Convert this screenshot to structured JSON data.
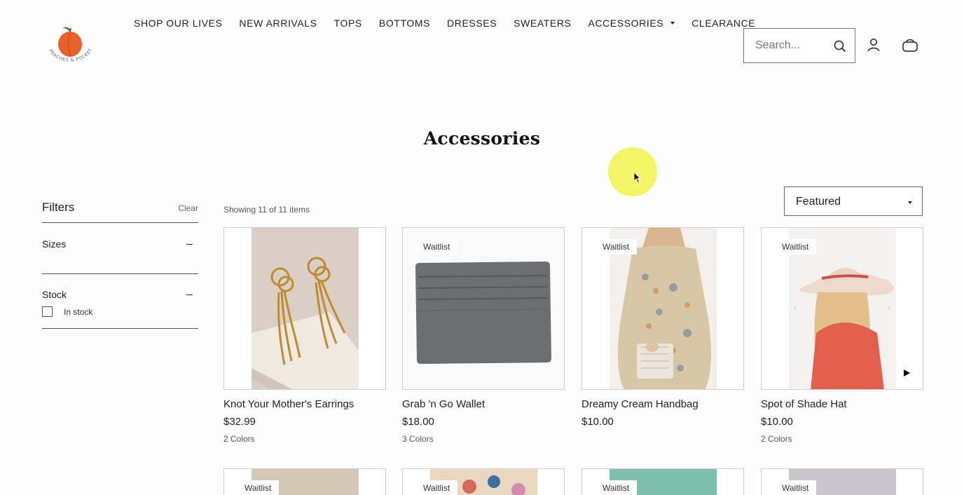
{
  "header": {
    "nav": [
      "SHOP OUR LIVES",
      "NEW ARRIVALS",
      "TOPS",
      "BOTTOMS",
      "DRESSES",
      "SWEATERS",
      "ACCESSORIES",
      "CLEARANCE"
    ],
    "search_placeholder": "Search...",
    "logo_text": "PEACHES & POCKETS"
  },
  "page": {
    "title": "Accessories"
  },
  "filters": {
    "title": "Filters",
    "clear": "Clear",
    "sections": [
      {
        "label": "Sizes"
      },
      {
        "label": "Stock",
        "options": [
          "In stock"
        ]
      }
    ]
  },
  "toolbar": {
    "showing": "Showing 11 of 11 items",
    "sort_selected": "Featured"
  },
  "products": [
    {
      "name": "Knot Your Mother's Earrings",
      "price": "$32.99",
      "colors": "2 Colors",
      "badge": ""
    },
    {
      "name": "Grab 'n Go Wallet",
      "price": "$18.00",
      "colors": "3 Colors",
      "badge": "Waitlist"
    },
    {
      "name": "Dreamy Cream Handbag",
      "price": "$10.00",
      "colors": "",
      "badge": "Waitlist"
    },
    {
      "name": "Spot of Shade Hat",
      "price": "$10.00",
      "colors": "2 Colors",
      "badge": "Waitlist"
    }
  ],
  "row2_badges": [
    "Waitlist",
    "Waitlist",
    "Waitlist",
    "Waitlist"
  ],
  "colors": {
    "accent_cursor": "#f3f35a",
    "peach": "#e8602c"
  }
}
